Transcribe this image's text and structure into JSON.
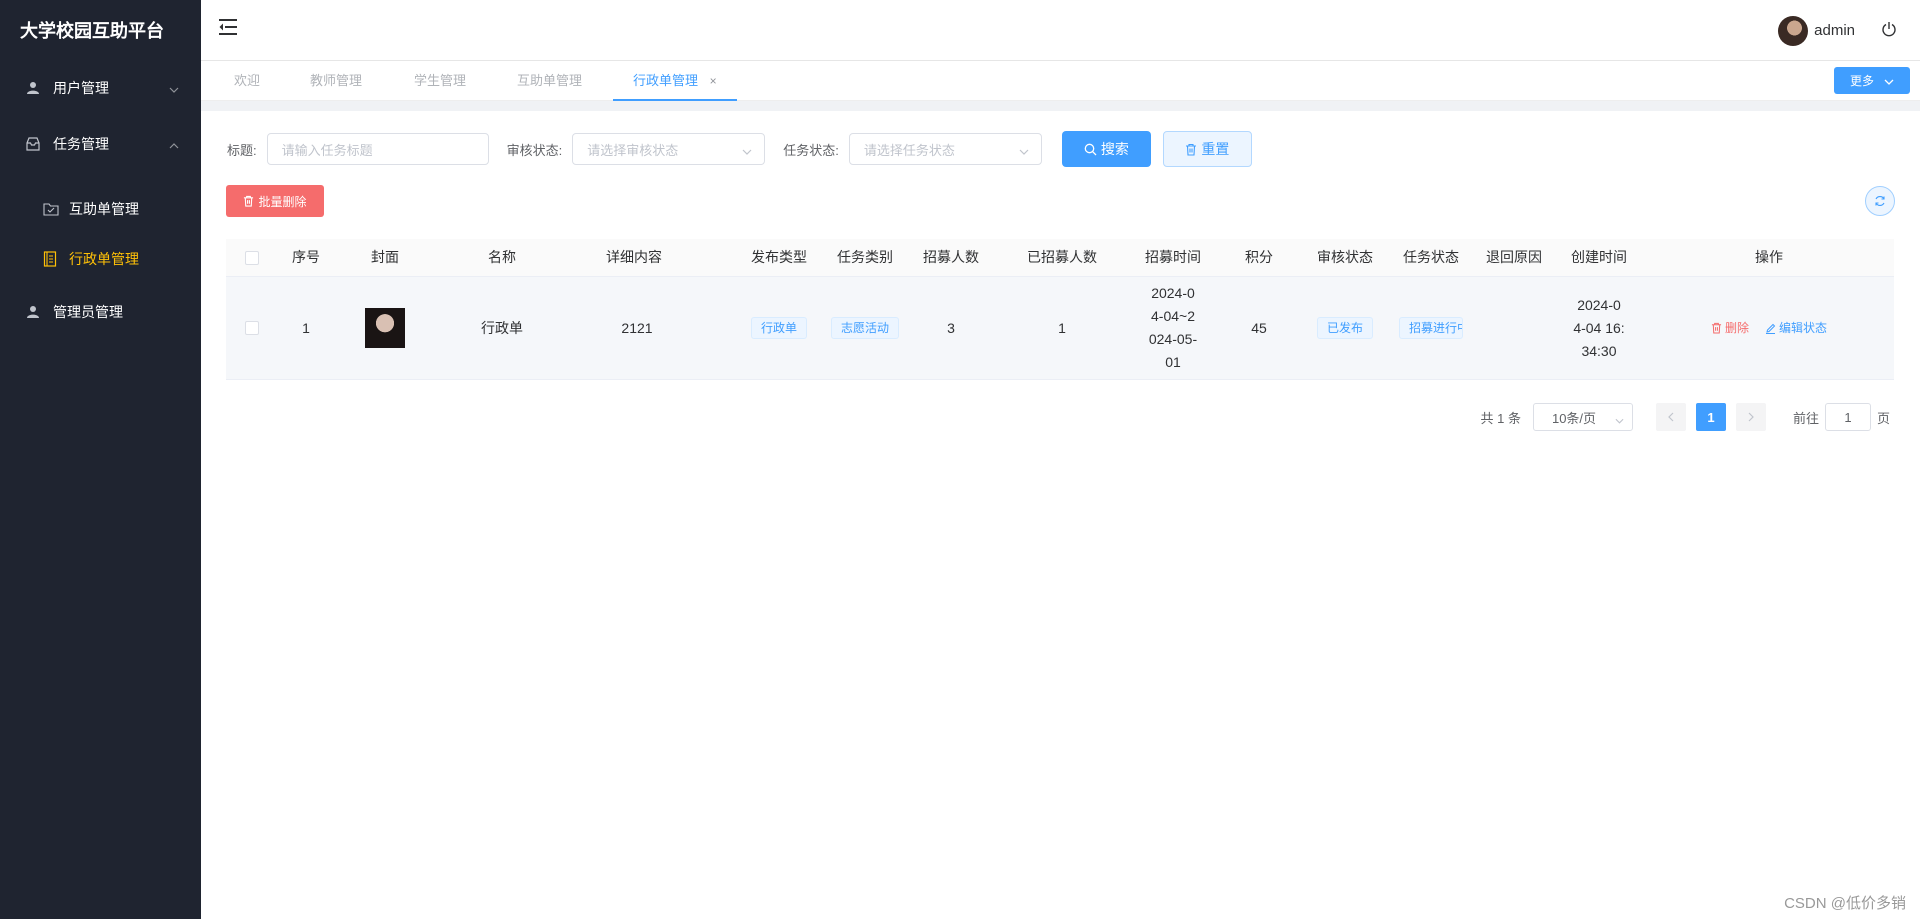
{
  "app": {
    "title": "大学校园互助平台"
  },
  "sidebar": {
    "items": [
      {
        "label": "用户管理",
        "icon": "user-icon"
      },
      {
        "label": "任务管理",
        "icon": "inbox-icon"
      },
      {
        "label": "互助单管理",
        "icon": "folder-icon"
      },
      {
        "label": "行政单管理",
        "icon": "notebook-icon"
      },
      {
        "label": "管理员管理",
        "icon": "user-icon"
      }
    ],
    "active_color": "#ffc107"
  },
  "header": {
    "username": "admin"
  },
  "tabs": {
    "items": [
      {
        "label": "欢迎"
      },
      {
        "label": "教师管理"
      },
      {
        "label": "学生管理"
      },
      {
        "label": "互助单管理"
      },
      {
        "label": "行政单管理"
      }
    ],
    "close": "×",
    "more_label": "更多"
  },
  "search": {
    "title_label": "标题:",
    "title_placeholder": "请输入任务标题",
    "audit_label": "审核状态:",
    "audit_placeholder": "请选择审核状态",
    "task_label": "任务状态:",
    "task_placeholder": "请选择任务状态",
    "search_label": "搜索",
    "reset_label": "重置"
  },
  "toolbar": {
    "batch_delete_label": "批量删除"
  },
  "table": {
    "columns": [
      "序号",
      "封面",
      "名称",
      "详细内容",
      "发布类型",
      "任务类别",
      "招募人数",
      "已招募人数",
      "招募时间",
      "积分",
      "审核状态",
      "任务状态",
      "退回原因",
      "创建时间",
      "操作"
    ],
    "rows": [
      {
        "index": "1",
        "name": "行政单",
        "detail": "2121",
        "publish_type": "行政单",
        "category": "志愿活动",
        "recruit": "3",
        "recruited": "1",
        "time_lines": [
          "2024-0",
          "4-04~2",
          "024-05-",
          "01"
        ],
        "points": "45",
        "audit": "已发布",
        "task_status": "招募进行中",
        "return_reason": "",
        "created_lines": [
          "2024-0",
          "4-04 16:",
          "34:30"
        ],
        "delete_label": "删除",
        "edit_label": "编辑状态"
      }
    ]
  },
  "pagination": {
    "total": "共 1 条",
    "page_size": "10条/页",
    "current": "1",
    "goto_label": "前往",
    "goto_value": "1",
    "page_suffix": "页"
  },
  "watermark": "CSDN @低价多销",
  "colors": {
    "primary": "#409eff",
    "danger": "#f56c6c",
    "sidebar_bg": "#1f2430"
  }
}
